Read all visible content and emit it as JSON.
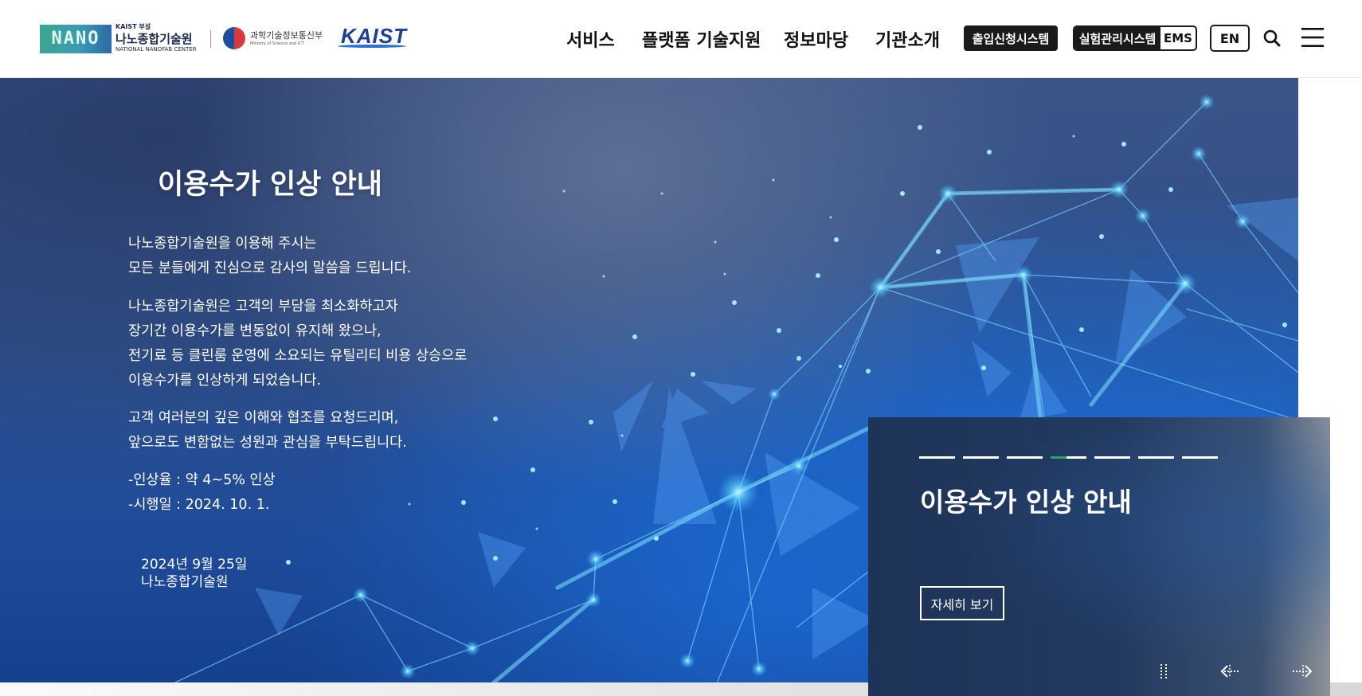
{
  "header": {
    "logo": {
      "mark": "NANO",
      "kaist_small": "KAIST 부설",
      "name_kr": "나노종합기술원",
      "name_en": "NATIONAL NANOFAB CENTER"
    },
    "ministry": {
      "name_kr": "과학기술정보통신부",
      "name_en": "Ministry of Science and ICT"
    },
    "kaist_logo": "KAIST",
    "nav": [
      "서비스",
      "플랫폼 기술지원",
      "정보마당",
      "기관소개"
    ],
    "access_system_label": "출입신청시스템",
    "lab_system_label": "실험관리시스템",
    "ems_label": "EMS",
    "language_label": "EN",
    "icons": {
      "search": "search-icon",
      "menu": "hamburger-menu-icon"
    }
  },
  "hero": {
    "title": "이용수가 인상 안내",
    "paragraphs": [
      [
        "나노종합기술원을 이용해 주시는",
        "모든 분들에게 진심으로 감사의 말씀을 드립니다."
      ],
      [
        "나노종합기술원은 고객의 부담을 최소화하고자",
        "장기간 이용수가를 변동없이 유지해 왔으나,",
        "전기료 등 클린룸 운영에 소요되는 유틸리티 비용 상승으로",
        "이용수가를 인상하게 되었습니다."
      ],
      [
        "고객 여러분의 깊은 이해와 협조를 요청드리며,",
        "앞으로도 변함없는 성원과 관심을 부탁드립니다."
      ],
      [
        "-인상율 : 약 4~5% 인상",
        "-시행일 : 2024. 10. 1."
      ]
    ],
    "date": "2024년 9월 25일",
    "organization": "나노종합기술원"
  },
  "slide_card": {
    "title": "이용수가 인상 안내",
    "more_label": "자세히 보기",
    "total_slides": 7,
    "active_slide": 4,
    "controls": [
      "pause-icon",
      "prev-arrow-icon",
      "next-arrow-icon"
    ]
  },
  "colors": {
    "nano_green": "#3aa88b",
    "kaist_blue": "#1b3f99",
    "dark_button": "#1a1a1a",
    "active_indicator": "#2fa36b"
  }
}
